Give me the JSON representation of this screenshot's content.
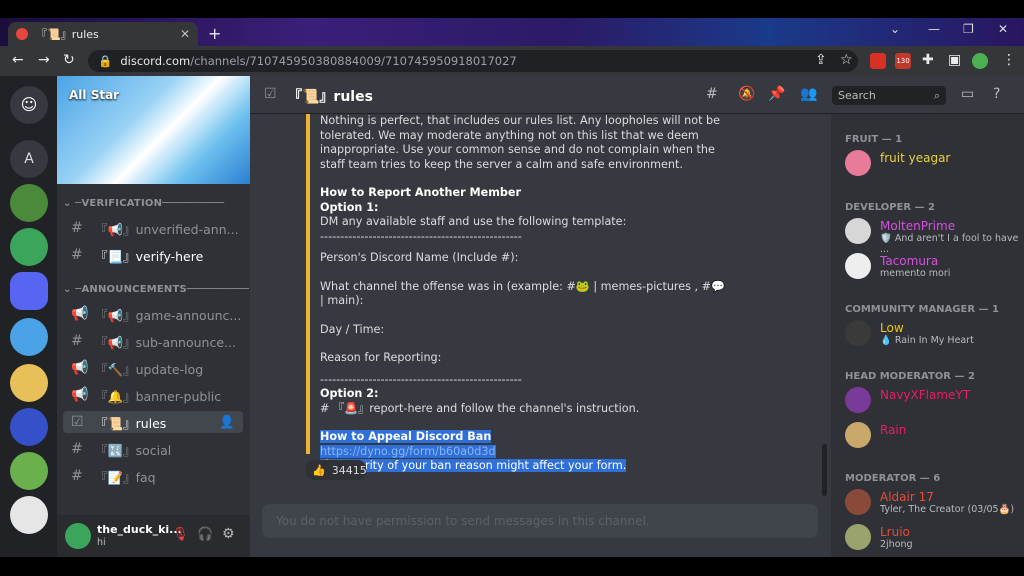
{
  "browser": {
    "tab_title": "『📜』rules",
    "url_host": "discord.com",
    "url_path": "/channels/710745950380884009/710745950918017027",
    "ext_badge": "130"
  },
  "server": {
    "name": "All Star"
  },
  "channels": {
    "cat_verification": "VERIFICATION",
    "cat_announcements": "ANNOUNCEMENTS",
    "items": [
      {
        "label": "『📢』unverified-ann..."
      },
      {
        "label": "『📃』verify-here"
      },
      {
        "label": "『📢』game-announc..."
      },
      {
        "label": "『📢』sub-announce..."
      },
      {
        "label": "『🔨』update-log"
      },
      {
        "label": "『🔔』banner-public"
      },
      {
        "label": "『📜』rules"
      },
      {
        "label": "『🔣』social"
      },
      {
        "label": "『📝』faq"
      }
    ]
  },
  "header": {
    "title": "『📜』rules",
    "search_placeholder": "Search"
  },
  "message": {
    "intro": "Nothing is perfect, that includes our rules list. Any loopholes will not be tolerated. We may moderate anything not on this list that we deem inappropriate. Use your common sense and do not complain when the staff team tries to keep the server a calm and safe environment.",
    "report_heading": "How to Report Another Member",
    "option1": "Option 1:",
    "option1_text": "DM any available staff and use the following template:",
    "divider": "--------------------------------------------------",
    "field_name": "Person's Discord Name (Include #):",
    "field_channel": "What channel the offense was in (example: #🐸 | memes-pictures , #💬 | main):",
    "field_day": "Day / Time:",
    "field_reason": "Reason for Reporting:",
    "option2": "Option 2:",
    "option2_text": "# 『🚨』report-here and follow the channel's instruction.",
    "appeal_heading": "How to Appeal Discord Ban",
    "appeal_link": "https://dyno.gg/form/b60a0d3d",
    "appeal_warning": "⚠️ Severity of your ban reason might affect your form."
  },
  "reaction": {
    "count": "34415"
  },
  "composer": {
    "placeholder": "You do not have permission to send messages in this channel."
  },
  "user": {
    "name": "the_duck_ki...",
    "status": "hi"
  },
  "members": {
    "groups": [
      {
        "title": "FRUIT — 1"
      },
      {
        "title": "DEVELOPER — 2"
      },
      {
        "title": "COMMUNITY MANAGER — 1"
      },
      {
        "title": "HEAD MODERATOR — 2"
      },
      {
        "title": "MODERATOR — 6"
      }
    ],
    "list": [
      {
        "name": "fruit yeagar",
        "status": "",
        "color": "#e8d33a"
      },
      {
        "name": "MoltenPrime",
        "status": "🛡️ And aren't I a fool to have ...",
        "color": "#d64fe0"
      },
      {
        "name": "Tacomura",
        "status": "memento mori",
        "color": "#d64fe0"
      },
      {
        "name": "Low",
        "status": "💧 Rain In My Heart",
        "color": "#f1c40f"
      },
      {
        "name": "NavyXFlameYT",
        "status": "",
        "color": "#e91e63"
      },
      {
        "name": "Rain",
        "status": "",
        "color": "#e91e63"
      },
      {
        "name": "Aldair 17",
        "status": "Tyler, The Creator (03/05🎂)",
        "color": "#e74c3c"
      },
      {
        "name": "Lruio",
        "status": "2jhong",
        "color": "#e74c3c"
      }
    ]
  }
}
